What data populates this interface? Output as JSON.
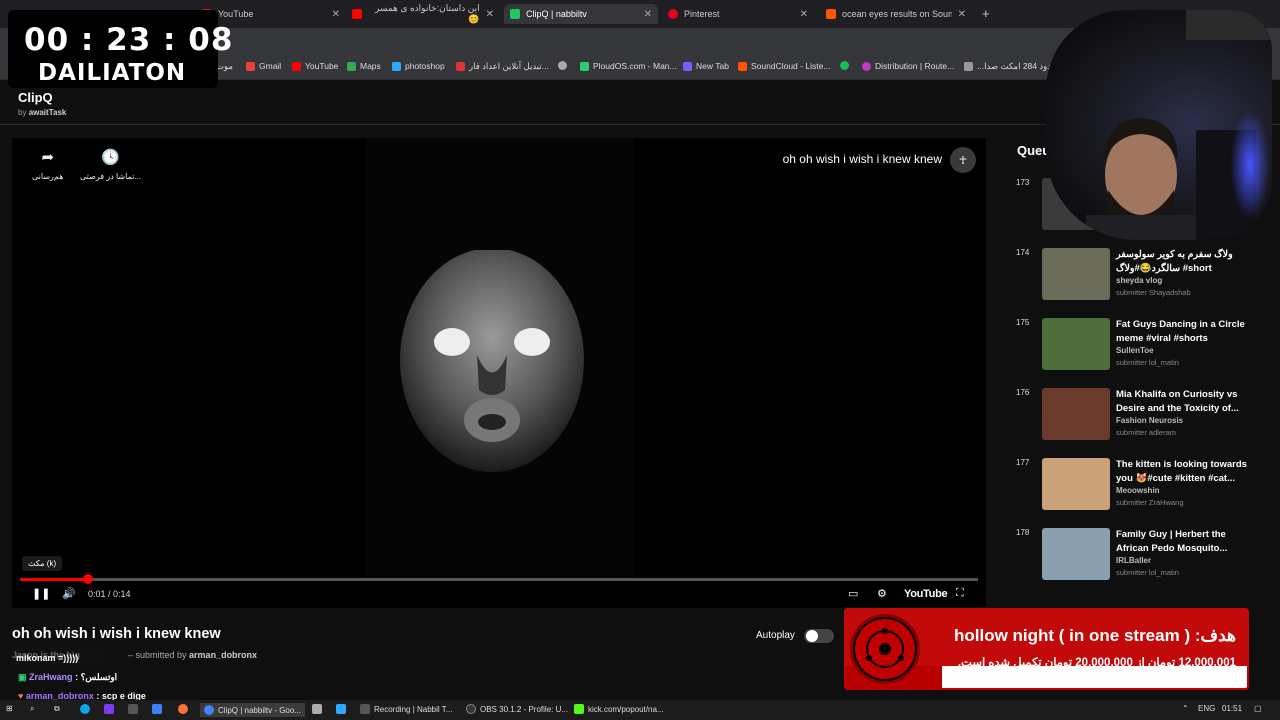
{
  "colors": {
    "accent_red": "#ff0000",
    "bg": "#0f0f0f",
    "donation_red": "#c20a0a"
  },
  "browser": {
    "tabs": [
      {
        "label": "YouTube",
        "icon": "youtube-icon",
        "color": "#ff0000"
      },
      {
        "label": "این داستان:خانواده ی همسر😊",
        "icon": "youtube-icon",
        "color": "#ff0000"
      },
      {
        "label": "ClipQ | nabbiltv",
        "icon": "play-icon",
        "color": "#22c55e"
      },
      {
        "label": "Pinterest",
        "icon": "pinterest-icon",
        "color": "#e60023"
      },
      {
        "label": "ocean eyes results on SoundCl...",
        "icon": "soundcloud-icon",
        "color": "#ff5500"
      }
    ],
    "new_tab": "+",
    "bookmarks": [
      {
        "label": "موت",
        "color": "#888888"
      },
      {
        "label": "Gmail",
        "color": "#ea4335"
      },
      {
        "label": "YouTube",
        "color": "#ff0000"
      },
      {
        "label": "Maps",
        "color": "#34a853"
      },
      {
        "label": "photoshop",
        "color": "#31a8ff"
      },
      {
        "label": "تبدیل آنلاین اعداد فار...",
        "color": "#d33"
      },
      {
        "label": "",
        "color": "#aaaaaa"
      },
      {
        "label": "PloudOS.com - Man...",
        "color": "#2ecc71"
      },
      {
        "label": "New Tab",
        "color": "#7b5cff"
      },
      {
        "label": "SoundCloud - Liste...",
        "color": "#ff5500"
      },
      {
        "label": "",
        "color": "#1db954"
      },
      {
        "label": "Distribution | Route...",
        "color": "#c03cc0"
      },
      {
        "label": "دود 284 امکث صدا...",
        "color": "#999999"
      }
    ]
  },
  "app": {
    "title": "ClipQ",
    "by_prefix": "by",
    "by_name": "awaitTask"
  },
  "player": {
    "video_title": "oh oh wish i wish i knew knew",
    "share_label": "هم‌رسانی",
    "watch_later_label": "تماشا در فرصتی...",
    "tooltip": "مکث (k)",
    "timecode": "0:01 / 0:14",
    "progress": 0.0714,
    "youtube_logo": "YouTube"
  },
  "below": {
    "title": "oh oh wish i wish i knew knew",
    "submitted_prefix": "– submitted by",
    "submitted_by": "arman_dobronx",
    "autoplay_label": "Autoplay"
  },
  "queue": {
    "title": "Queue",
    "items": [
      {
        "num": "173",
        "title": "",
        "channel": "",
        "submitter": "",
        "thumb": "#3b3b3b"
      },
      {
        "num": "174",
        "title": "ولاگ سفرم به کویر سولوسفر سالگرد😂#ولاگ #short",
        "channel": "sheyda vlog",
        "submitter": "submitter Shayadshab",
        "thumb": "#6b6b5a"
      },
      {
        "num": "175",
        "title": "Fat Guys Dancing in a Circle meme #viral #shorts",
        "channel": "SullenToe",
        "submitter": "submitter lol_matin",
        "thumb": "#4e6e3c"
      },
      {
        "num": "176",
        "title": "Mia Khalifa on Curiosity vs Desire and the Toxicity of...",
        "channel": "Fashion Neurosis",
        "submitter": "submitter adleram",
        "thumb": "#6a3a2a"
      },
      {
        "num": "177",
        "title": "The kitten is looking towards you 😻#cute #kitten #cat...",
        "channel": "Meoowshin",
        "submitter": "submitter ZraHwang",
        "thumb": "#c9a27a"
      },
      {
        "num": "178",
        "title": "Family Guy | Herbert the African Pedo Mosquito...",
        "channel": "IRLBaller",
        "submitter": "submitter lol_matin",
        "thumb": "#8aa0b0"
      }
    ]
  },
  "overlay": {
    "timer": "00 : 23 : 08",
    "timer_label": "DAILIATON"
  },
  "chat": [
    {
      "user": "mikonam",
      "text": "=)))))",
      "color": "#ffffff"
    },
    {
      "user": "ZraHwang",
      "text": ": اوتسلس؟",
      "color": "#b18cff"
    },
    {
      "user": "arman_dobronx",
      "text": ": scp e dige",
      "color": "#a970ff"
    },
    {
      "user": "Jason",
      "text": "is the big",
      "color": "#666666"
    }
  ],
  "donation": {
    "title": "هدف: ( hollow night ( in one stream",
    "subtitle": "12,000,001 تومان از 20,000,000 تومان تکمیل شده است.",
    "progress": 0.6
  },
  "taskbar": {
    "items": [
      {
        "label": "ClipQ | nabbiltv - Goo...",
        "color": "#4285f4"
      },
      {
        "label": "Recording | Nabbil T...",
        "color": "#555555"
      },
      {
        "label": "OBS 30.1.2 - Profile: U...",
        "color": "#333333"
      },
      {
        "label": "kick.com/popout/na...",
        "color": "#53fc18"
      }
    ],
    "lang": "ENG",
    "time": "01:51"
  }
}
